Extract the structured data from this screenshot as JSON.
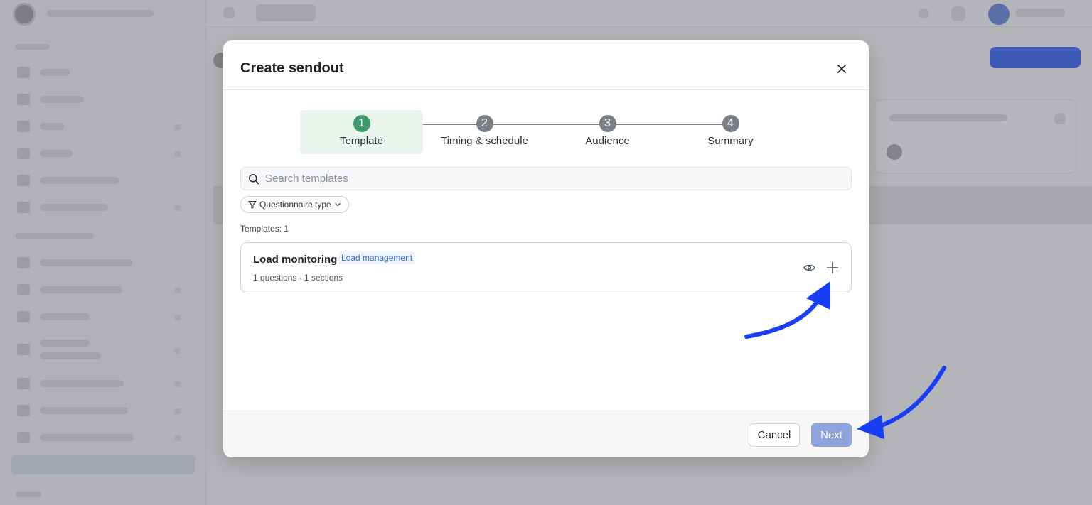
{
  "modal": {
    "title": "Create sendout",
    "close_icon": "close-icon"
  },
  "stepper": {
    "steps": [
      {
        "number": "1",
        "label": "Template",
        "active": true
      },
      {
        "number": "2",
        "label": "Timing & schedule",
        "active": false
      },
      {
        "number": "3",
        "label": "Audience",
        "active": false
      },
      {
        "number": "4",
        "label": "Summary",
        "active": false
      }
    ]
  },
  "search": {
    "placeholder": "Search templates",
    "value": "",
    "icon": "search-icon"
  },
  "filter": {
    "label": "Questionnaire type",
    "icon": "filter-icon"
  },
  "templates": {
    "count_label": "Templates: 1",
    "items": [
      {
        "title": "Load monitoring",
        "tag": "Load management",
        "meta": "1 questions · 1 sections"
      }
    ]
  },
  "footer": {
    "cancel_label": "Cancel",
    "next_label": "Next"
  },
  "colors": {
    "active_step": "#3d9a6b",
    "active_step_bg": "#e8f4ec",
    "next_button": "#8ea3dc",
    "tag_text": "#2f6fd6",
    "annotation_arrow": "#1a3ef5"
  }
}
